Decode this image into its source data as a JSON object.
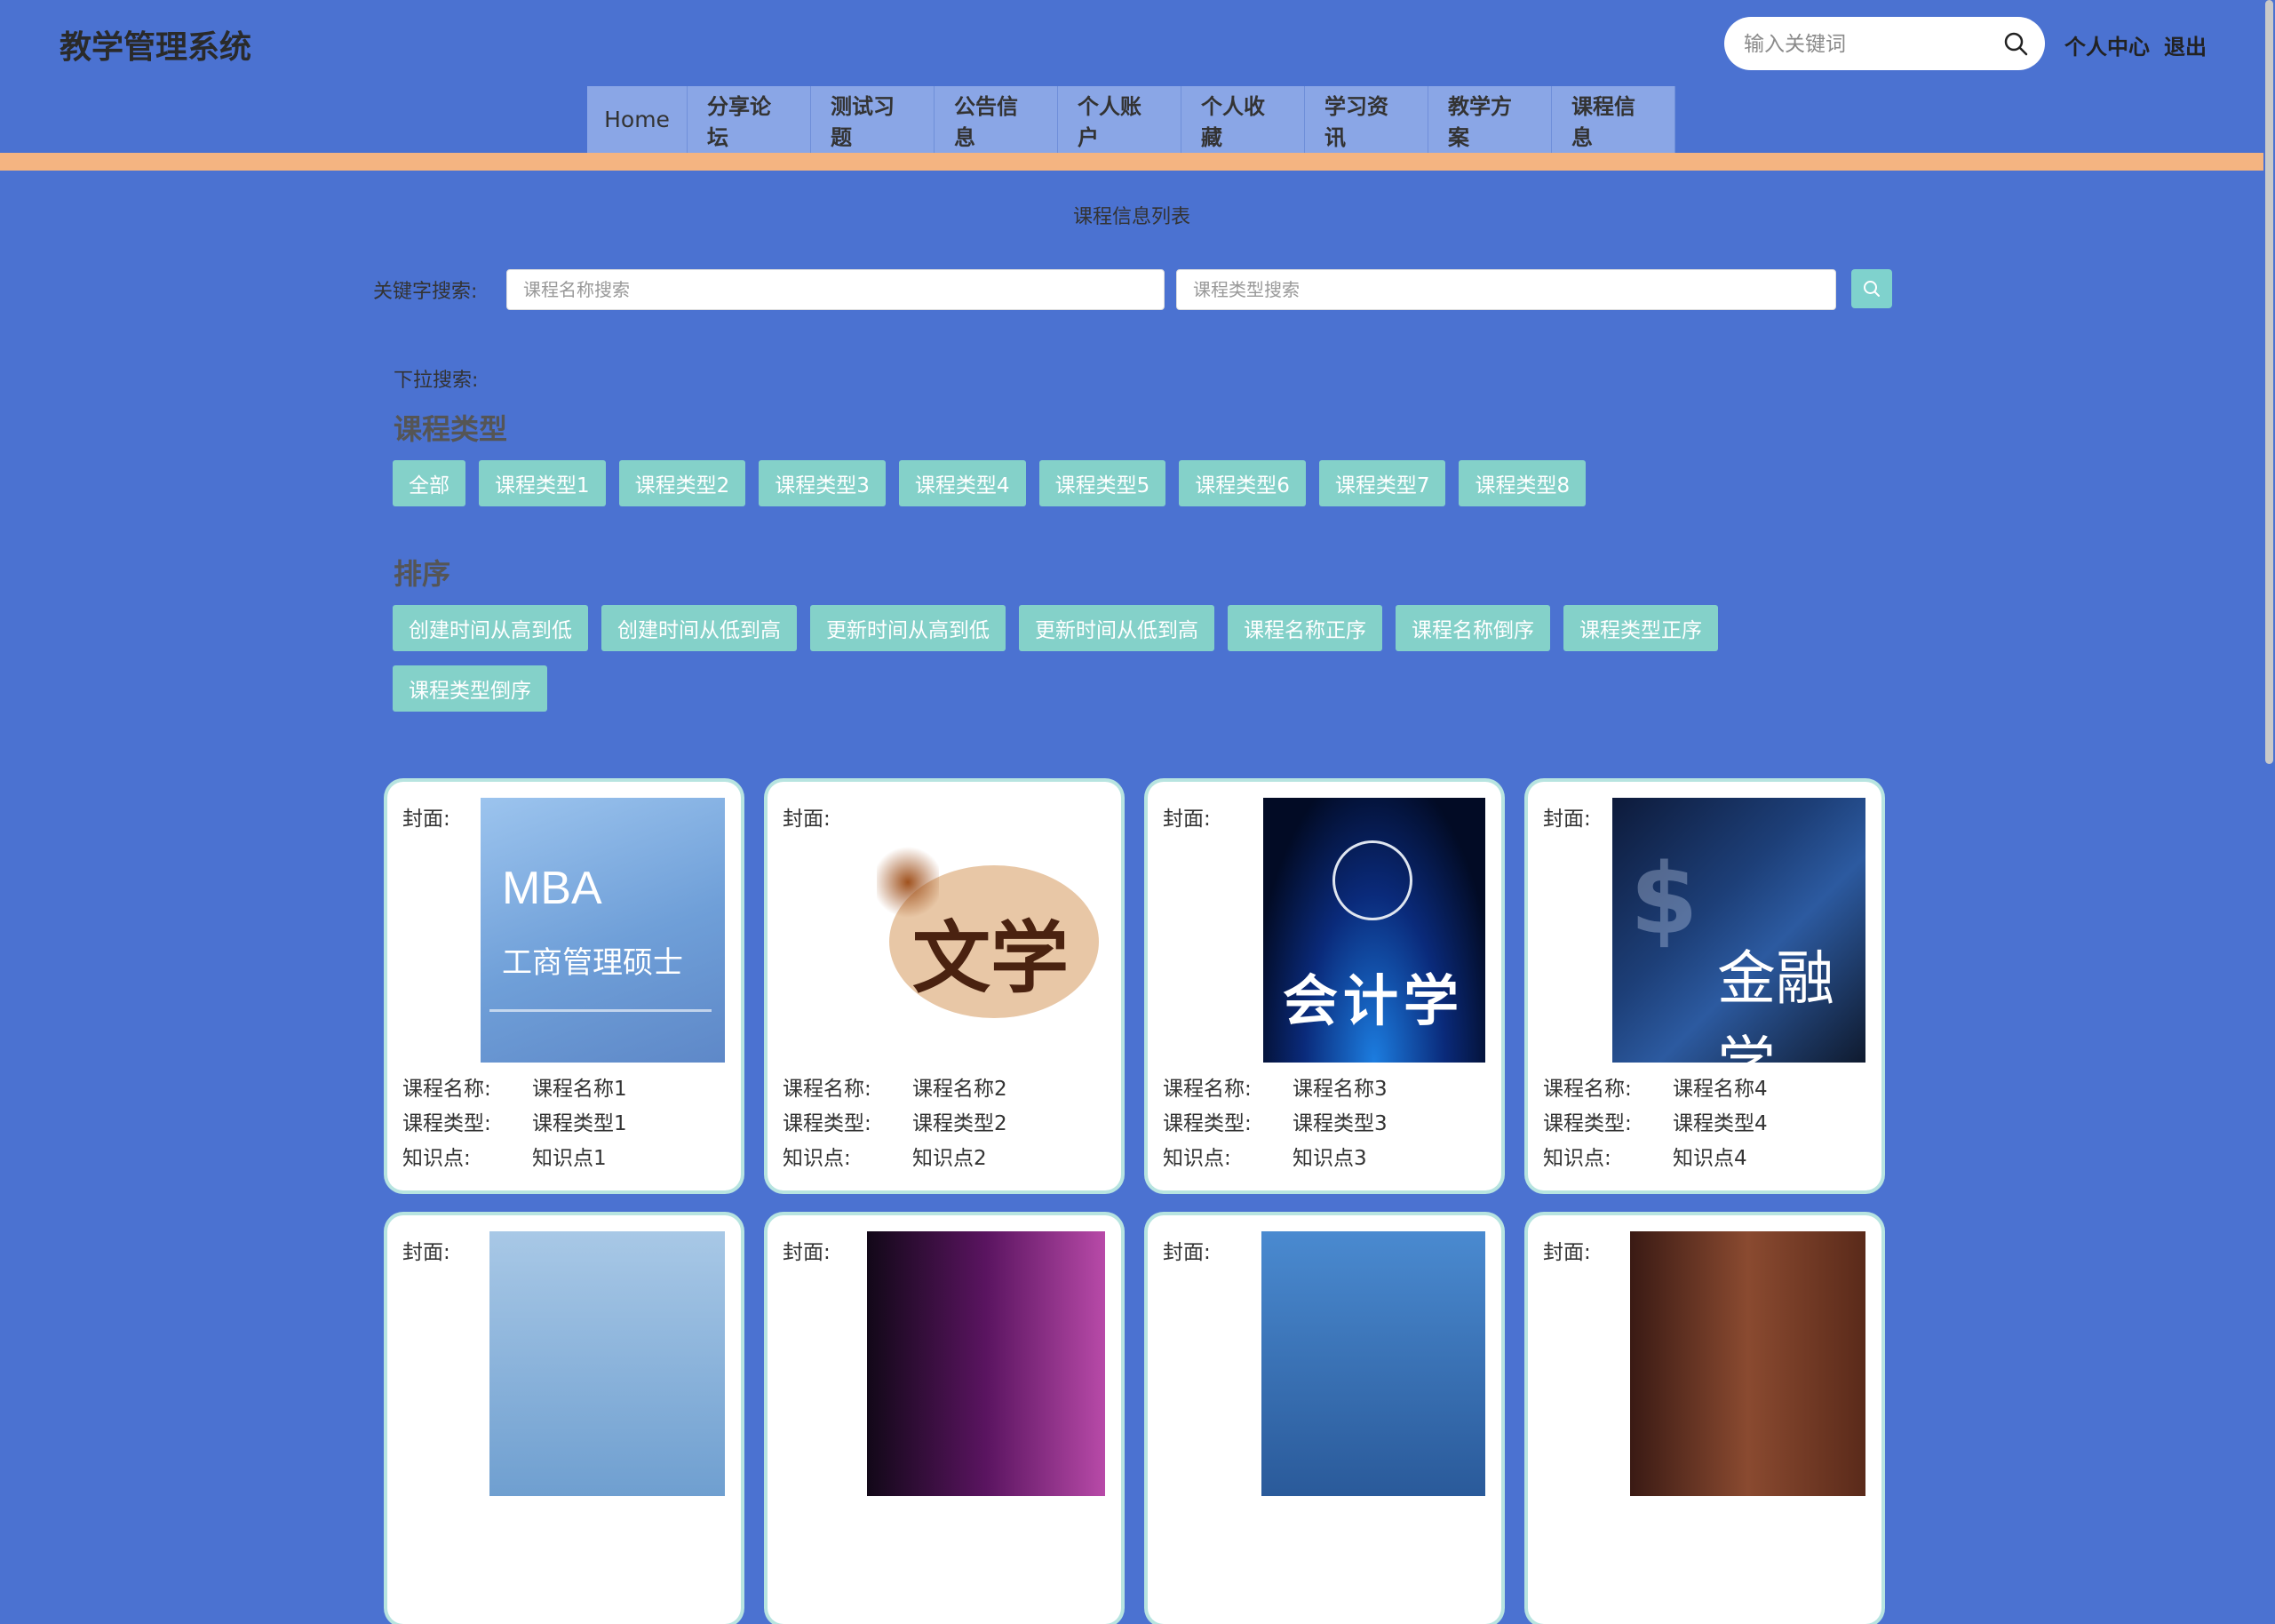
{
  "header": {
    "site_title": "教学管理系统",
    "search_placeholder": "输入关键词",
    "user_center": "个人中心",
    "logout": "退出"
  },
  "nav": [
    "Home",
    "分享论坛",
    "测试习题",
    "公告信息",
    "个人账户",
    "个人收藏",
    "学习资讯",
    "教学方案",
    "课程信息"
  ],
  "page": {
    "list_title": "课程信息列表",
    "keyword_label": "关键字搜索:",
    "name_placeholder": "课程名称搜索",
    "type_placeholder": "课程类型搜索",
    "dropdown_label": "下拉搜索:",
    "type_section_title": "课程类型",
    "type_chips": [
      "全部",
      "课程类型1",
      "课程类型2",
      "课程类型3",
      "课程类型4",
      "课程类型5",
      "课程类型6",
      "课程类型7",
      "课程类型8"
    ],
    "sort_section_title": "排序",
    "sort_chips": [
      "创建时间从高到低",
      "创建时间从低到高",
      "更新时间从高到低",
      "更新时间从低到高",
      "课程名称正序",
      "课程名称倒序",
      "课程类型正序",
      "课程类型倒序"
    ]
  },
  "card_labels": {
    "cover": "封面:",
    "name": "课程名称:",
    "type": "课程类型:",
    "point": "知识点:"
  },
  "cards": [
    {
      "cover_text_1": "MBA",
      "cover_text_2": "工商管理硕士",
      "name": "课程名称1",
      "type": "课程类型1",
      "point": "知识点1"
    },
    {
      "cover_text_1": "文学",
      "name": "课程名称2",
      "type": "课程类型2",
      "point": "知识点2"
    },
    {
      "cover_text_1": "会计学",
      "name": "课程名称3",
      "type": "课程类型3",
      "point": "知识点3"
    },
    {
      "cover_text_1": "金融学",
      "name": "课程名称4",
      "type": "课程类型4",
      "point": "知识点4"
    },
    {
      "name": "",
      "type": "",
      "point": ""
    },
    {
      "name": "",
      "type": "",
      "point": ""
    },
    {
      "name": "",
      "type": "",
      "point": ""
    },
    {
      "name": "",
      "type": "",
      "point": ""
    }
  ],
  "colors": {
    "background": "#4b72d1",
    "accent_bar": "#f4b481",
    "chip": "#84d1c9",
    "nav_item": "#8aa6e6"
  }
}
